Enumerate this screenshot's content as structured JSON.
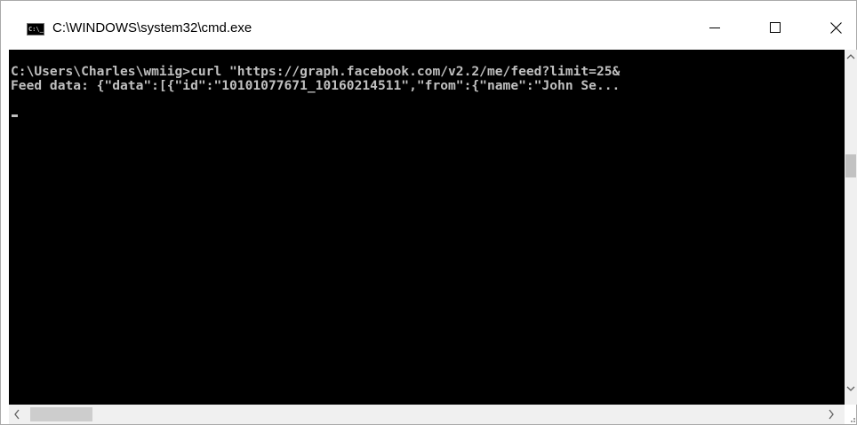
{
  "window": {
    "title": "C:\\WINDOWS\\system32\\cmd.exe",
    "icon": "cmd-icon",
    "icon_text": "C:\\_",
    "controls": [
      "minimize-icon",
      "maximize-icon",
      "close-icon"
    ]
  },
  "console": {
    "lines": [
      "C:\\Users\\Charles\\wmiig>curl \"https://graph.facebook.com/v2.2/me/feed?limit=25&",
      "Feed data: {\"data\":[{\"id\":\"10101077671_10160214511\",\"from\":{\"name\":\"John Se..."
    ],
    "text_color": "#c0c0c0",
    "background": "#000000"
  },
  "scrollbars": {
    "vertical_arrows": [
      "chevron-up-icon",
      "chevron-down-icon"
    ],
    "horizontal_arrows": [
      "chevron-left-icon",
      "chevron-right-icon"
    ]
  }
}
